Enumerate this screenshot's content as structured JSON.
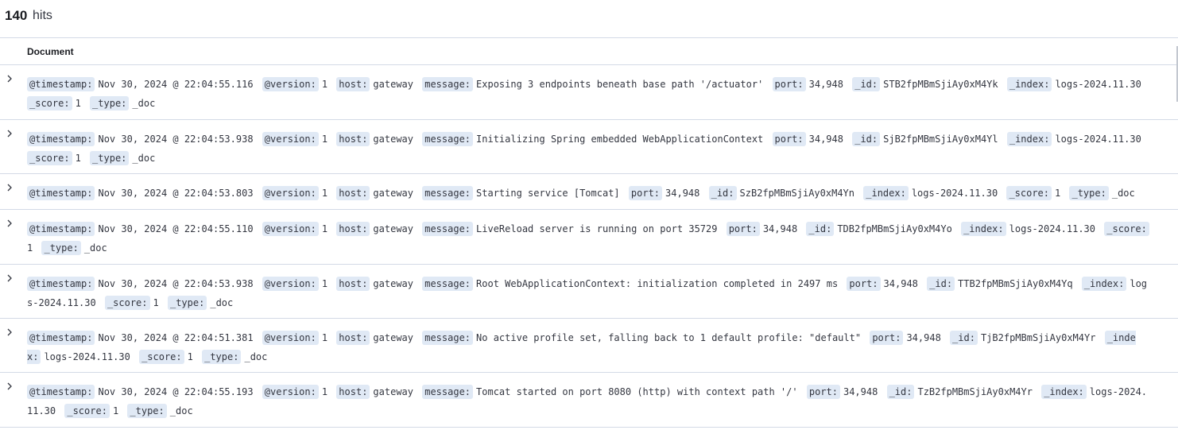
{
  "hits": {
    "count": "140",
    "label": "hits"
  },
  "table": {
    "column_header": "Document"
  },
  "icons": {
    "expand": "chevron-right-icon"
  },
  "colors": {
    "key_badge_bg": "#e0e9f5",
    "border": "#d3dae6"
  },
  "rows": [
    {
      "fields": [
        {
          "key": "@timestamp:",
          "value": "Nov 30, 2024 @ 22:04:55.116"
        },
        {
          "key": "@version:",
          "value": "1"
        },
        {
          "key": "host:",
          "value": "gateway"
        },
        {
          "key": "message:",
          "value": "Exposing 3 endpoints beneath base path '/actuator'"
        },
        {
          "key": "port:",
          "value": "34,948"
        },
        {
          "key": "_id:",
          "value": "STB2fpMBmSjiAy0xM4Yk"
        },
        {
          "key": "_index:",
          "value": "logs-2024.11.30"
        },
        {
          "key": "_score:",
          "value": "1"
        },
        {
          "key": "_type:",
          "value": "_doc"
        }
      ]
    },
    {
      "fields": [
        {
          "key": "@timestamp:",
          "value": "Nov 30, 2024 @ 22:04:53.938"
        },
        {
          "key": "@version:",
          "value": "1"
        },
        {
          "key": "host:",
          "value": "gateway"
        },
        {
          "key": "message:",
          "value": "Initializing Spring embedded WebApplicationContext"
        },
        {
          "key": "port:",
          "value": "34,948"
        },
        {
          "key": "_id:",
          "value": "SjB2fpMBmSjiAy0xM4Yl"
        },
        {
          "key": "_index:",
          "value": "logs-2024.11.30"
        },
        {
          "key": "_score:",
          "value": "1"
        },
        {
          "key": "_type:",
          "value": "_doc"
        }
      ]
    },
    {
      "fields": [
        {
          "key": "@timestamp:",
          "value": "Nov 30, 2024 @ 22:04:53.803"
        },
        {
          "key": "@version:",
          "value": "1"
        },
        {
          "key": "host:",
          "value": "gateway"
        },
        {
          "key": "message:",
          "value": "Starting service [Tomcat]"
        },
        {
          "key": "port:",
          "value": "34,948"
        },
        {
          "key": "_id:",
          "value": "SzB2fpMBmSjiAy0xM4Yn"
        },
        {
          "key": "_index:",
          "value": "logs-2024.11.30"
        },
        {
          "key": "_score:",
          "value": "1"
        },
        {
          "key": "_type:",
          "value": "_doc"
        }
      ]
    },
    {
      "fields": [
        {
          "key": "@timestamp:",
          "value": "Nov 30, 2024 @ 22:04:55.110"
        },
        {
          "key": "@version:",
          "value": "1"
        },
        {
          "key": "host:",
          "value": "gateway"
        },
        {
          "key": "message:",
          "value": "LiveReload server is running on port 35729"
        },
        {
          "key": "port:",
          "value": "34,948"
        },
        {
          "key": "_id:",
          "value": "TDB2fpMBmSjiAy0xM4Yo"
        },
        {
          "key": "_index:",
          "value": "logs-2024.11.30"
        },
        {
          "key": "_score:",
          "value": "1"
        },
        {
          "key": "_type:",
          "value": "_doc"
        }
      ]
    },
    {
      "fields": [
        {
          "key": "@timestamp:",
          "value": "Nov 30, 2024 @ 22:04:53.938"
        },
        {
          "key": "@version:",
          "value": "1"
        },
        {
          "key": "host:",
          "value": "gateway"
        },
        {
          "key": "message:",
          "value": "Root WebApplicationContext: initialization completed in 2497 ms"
        },
        {
          "key": "port:",
          "value": "34,948"
        },
        {
          "key": "_id:",
          "value": "TTB2fpMBmSjiAy0xM4Yq"
        },
        {
          "key": "_index:",
          "value": "logs-2024.11.30"
        },
        {
          "key": "_score:",
          "value": "1"
        },
        {
          "key": "_type:",
          "value": "_doc"
        }
      ]
    },
    {
      "fields": [
        {
          "key": "@timestamp:",
          "value": "Nov 30, 2024 @ 22:04:51.381"
        },
        {
          "key": "@version:",
          "value": "1"
        },
        {
          "key": "host:",
          "value": "gateway"
        },
        {
          "key": "message:",
          "value": "No active profile set, falling back to 1 default profile: \"default\""
        },
        {
          "key": "port:",
          "value": "34,948"
        },
        {
          "key": "_id:",
          "value": "TjB2fpMBmSjiAy0xM4Yr"
        },
        {
          "key": "_index:",
          "value": "logs-2024.11.30"
        },
        {
          "key": "_score:",
          "value": "1"
        },
        {
          "key": "_type:",
          "value": "_doc"
        }
      ]
    },
    {
      "fields": [
        {
          "key": "@timestamp:",
          "value": "Nov 30, 2024 @ 22:04:55.193"
        },
        {
          "key": "@version:",
          "value": "1"
        },
        {
          "key": "host:",
          "value": "gateway"
        },
        {
          "key": "message:",
          "value": "Tomcat started on port 8080 (http) with context path '/'"
        },
        {
          "key": "port:",
          "value": "34,948"
        },
        {
          "key": "_id:",
          "value": "TzB2fpMBmSjiAy0xM4Yr"
        },
        {
          "key": "_index:",
          "value": "logs-2024.11.30"
        },
        {
          "key": "_score:",
          "value": "1"
        },
        {
          "key": "_type:",
          "value": "_doc"
        }
      ]
    }
  ]
}
